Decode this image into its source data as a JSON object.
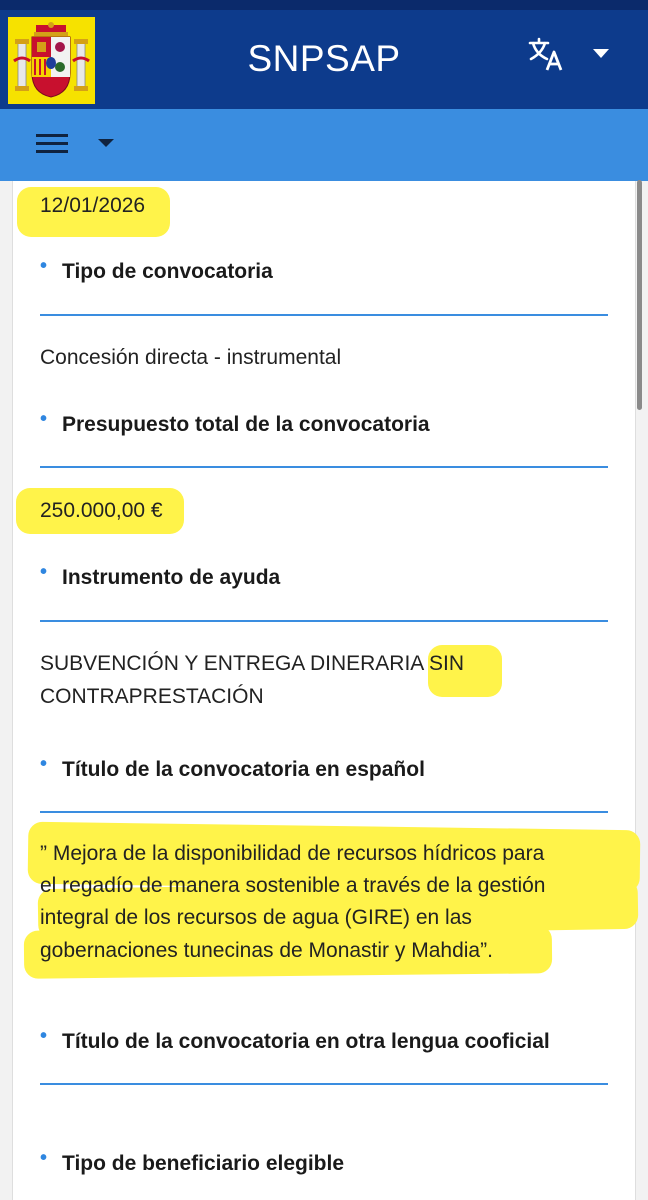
{
  "header": {
    "title": "SNPSAP",
    "language_icon": "translate-icon",
    "menu_icon": "hamburger-menu-icon"
  },
  "colors": {
    "header_bg": "#0d3b8c",
    "subbar_bg": "#3a8de0",
    "highlight": "#fff34a",
    "bullet": "#2f86e0"
  },
  "fields": {
    "date_value": "12/01/2026",
    "tipo_label": "Tipo de convocatoria",
    "tipo_value": "Concesión directa - instrumental",
    "presupuesto_label": "Presupuesto total de la convocatoria",
    "presupuesto_value": "250.000,00 €",
    "instrumento_label": "Instrumento de ayuda",
    "instrumento_value_line1": "SUBVENCIÓN Y ENTREGA DINERARIA SIN",
    "instrumento_value_line2": "CONTRAPRESTACIÓN",
    "titulo_es_label": "Título de la convocatoria en español",
    "titulo_es_line1": "” Mejora de la disponibilidad de recursos hídricos para",
    "titulo_es_line2": "el regadío de manera sostenible a través de la gestión",
    "titulo_es_line3": "integral de los recursos de agua (GIRE) en las",
    "titulo_es_line4": "gobernaciones tunecinas de Monastir y Mahdia”.",
    "titulo_otra_label": "Título de la convocatoria en otra lengua cooficial",
    "beneficiario_label": "Tipo de beneficiario elegible"
  }
}
